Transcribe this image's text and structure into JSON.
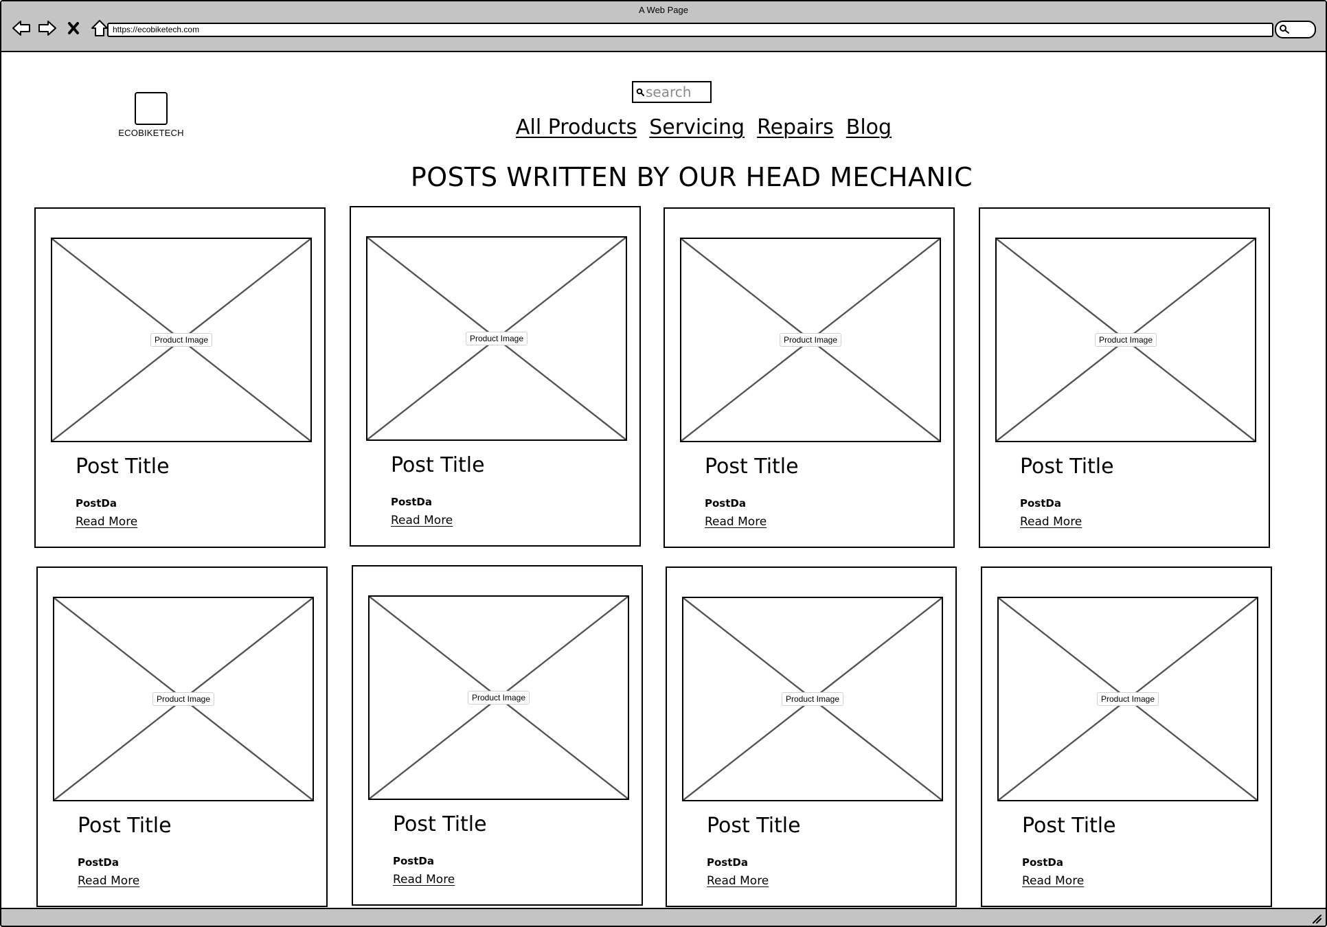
{
  "window": {
    "title": "A Web Page"
  },
  "browser": {
    "url": "https://ecobiketech.com"
  },
  "logo": {
    "text": "ECOBIKETECH"
  },
  "search": {
    "placeholder": "search"
  },
  "nav": {
    "all_products": "All Products",
    "servicing": "Servicing",
    "repairs": "Repairs",
    "blog": "Blog"
  },
  "heading": "POSTS WRITTEN BY OUR HEAD MECHANIC",
  "posts": [
    {
      "image_label": "Product Image",
      "title": "Post Title",
      "date": "PostDa",
      "link": "Read More"
    },
    {
      "image_label": "Product Image",
      "title": "Post Title",
      "date": "PostDa",
      "link": "Read More"
    },
    {
      "image_label": "Product Image",
      "title": "Post Title",
      "date": "PostDa",
      "link": "Read More"
    },
    {
      "image_label": "Product Image",
      "title": "Post Title",
      "date": "PostDa",
      "link": "Read More"
    },
    {
      "image_label": "Product Image",
      "title": "Post Title",
      "date": "PostDa",
      "link": "Read More"
    },
    {
      "image_label": "Product Image",
      "title": "Post Title",
      "date": "PostDa",
      "link": "Read More"
    },
    {
      "image_label": "Product Image",
      "title": "Post Title",
      "date": "PostDa",
      "link": "Read More"
    },
    {
      "image_label": "Product Image",
      "title": "Post Title",
      "date": "PostDa",
      "link": "Read More"
    }
  ]
}
